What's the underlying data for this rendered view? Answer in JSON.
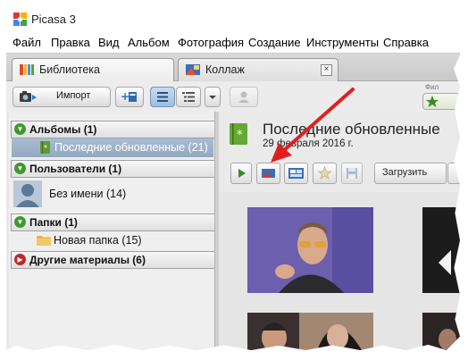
{
  "window": {
    "title": "Picasa 3"
  },
  "menu": [
    "Файл",
    "Правка",
    "Вид",
    "Альбом",
    "Фотография",
    "Создание",
    "Инструменты",
    "Справка"
  ],
  "tabs": [
    {
      "label": "Библиотека",
      "icon": "library-icon",
      "active": true
    },
    {
      "label": "Коллаж",
      "icon": "collage-icon",
      "active": false
    }
  ],
  "toolbar": {
    "import_label": "Импорт",
    "faces_label": "Фил"
  },
  "left_panel": {
    "albums": {
      "label": "Альбомы (1)",
      "items": [
        {
          "label": "Последние обновленные (21)",
          "selected": true
        }
      ]
    },
    "people": {
      "label": "Пользователи (1)",
      "items": [
        {
          "label": "Без имени (14)"
        }
      ]
    },
    "folders": {
      "label": "Папки (1)",
      "items": [
        {
          "label": "Новая папка (15)"
        }
      ]
    },
    "other": {
      "label": "Другие материалы (6)"
    }
  },
  "album": {
    "title": "Последние обновленные",
    "date": "29 февраля 2016 г.",
    "upload_label": "Загрузить"
  },
  "colors": {
    "accent_blue": "#9dbee0",
    "selection": "#93a9c0",
    "arrow_red": "#e02020",
    "expander_green": "#3f9a2f",
    "expander_red": "#c42727"
  }
}
